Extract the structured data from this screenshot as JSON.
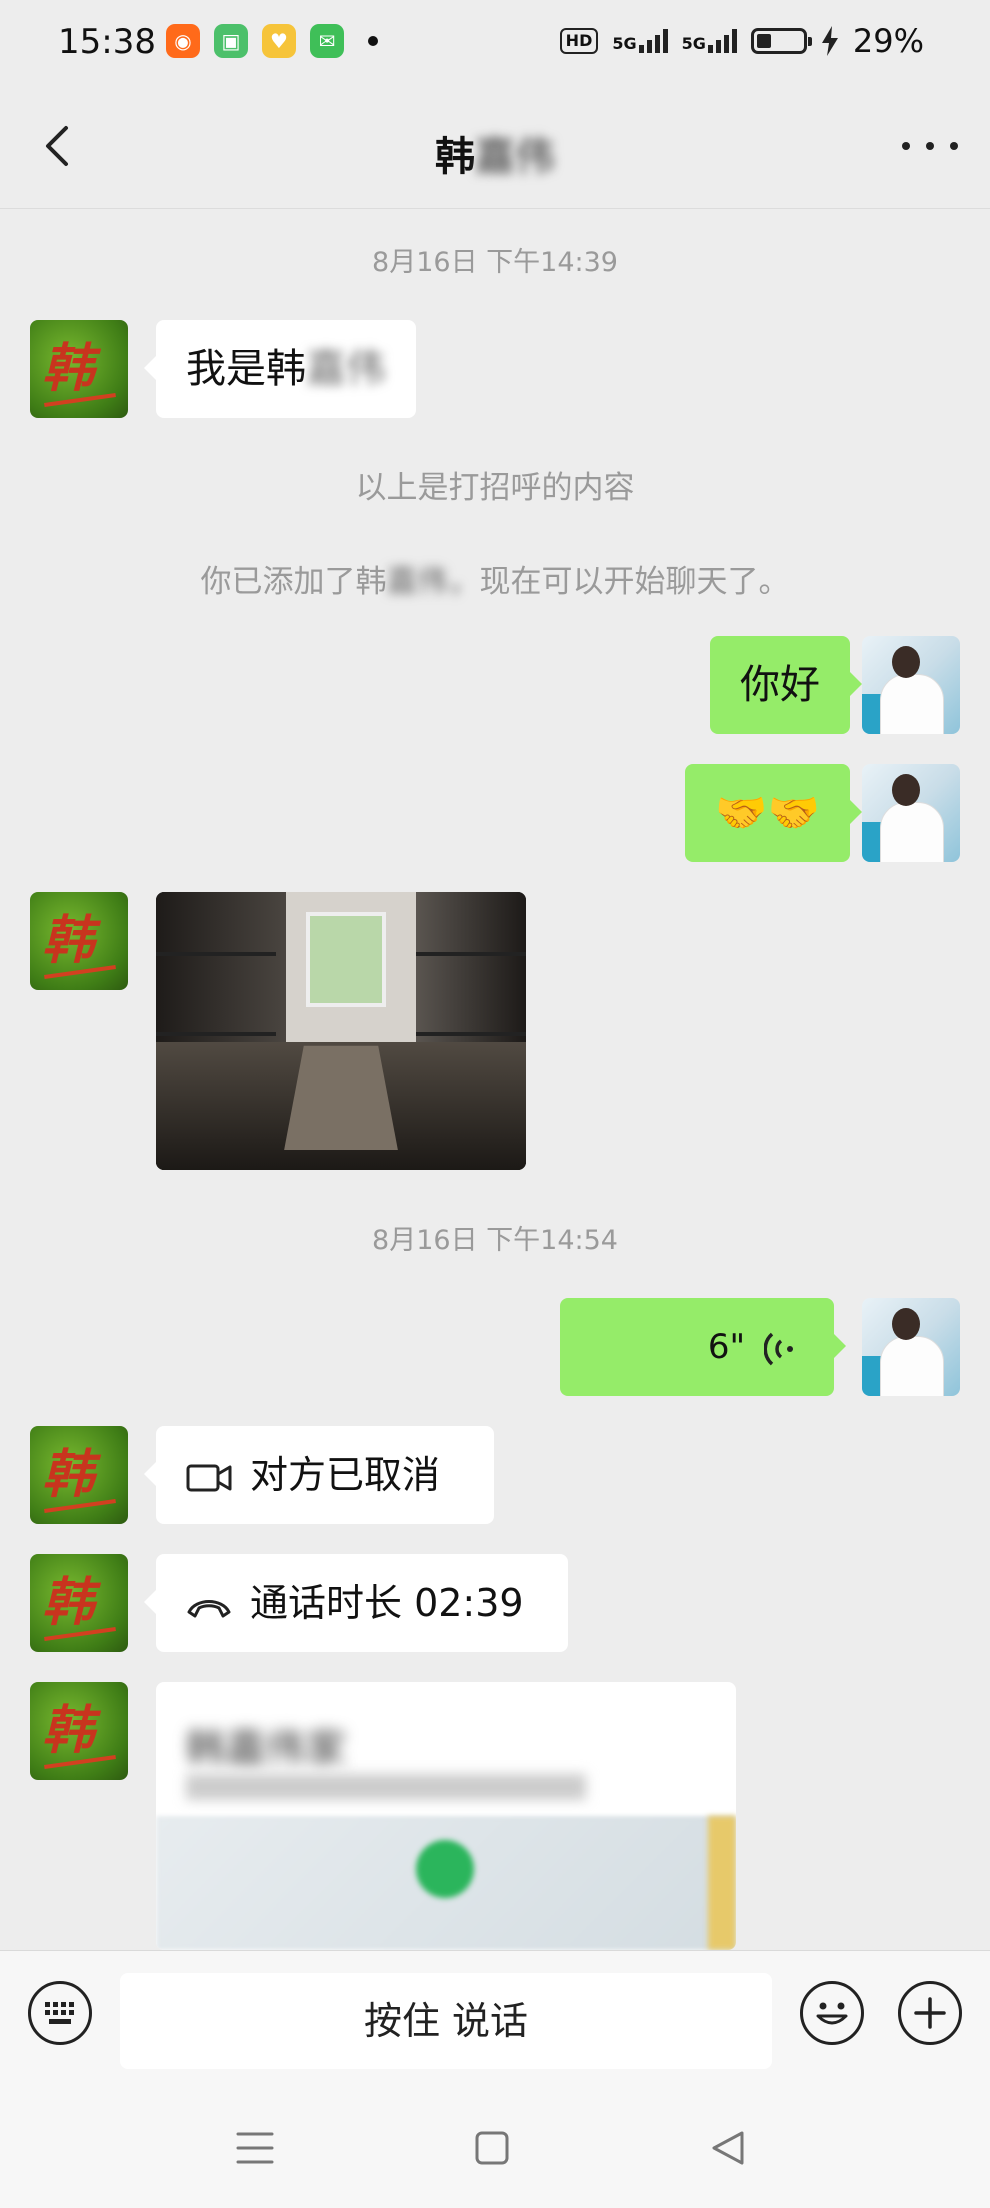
{
  "status_bar": {
    "time": "15:38",
    "app_icons": [
      {
        "name": "kuaishou-icon",
        "color": "#ff6a1a"
      },
      {
        "name": "green-app-icon",
        "color": "#4cc06a"
      },
      {
        "name": "yellow-app-icon",
        "color": "#f6c43a"
      },
      {
        "name": "message-app-icon",
        "color": "#3fbf58"
      }
    ],
    "hd": "HD",
    "network_1": "5G",
    "network_2": "5G",
    "battery": "29%",
    "battery_level": 0.29
  },
  "header": {
    "title_visible": "韩",
    "title_obscured": "嘉伟"
  },
  "messages": {
    "ts1": "8月16日 下午14:39",
    "greeting_prefix": "我是韩",
    "greeting_obscured": "嘉伟",
    "sys1": "以上是打招呼的内容",
    "sys2_a": "你已添加了韩",
    "sys2_obscured": "嘉伟，",
    "sys2_b": "现在可以开始聊天了。",
    "hello": "你好",
    "emoji": "🤝🤝",
    "ts2": "8月16日 下午14:54",
    "voice_duration": "6\"",
    "video_call": "对方已取消",
    "voice_call": "通话时长 02:39",
    "card_title_obscured": "韩嘉伟家"
  },
  "input": {
    "hold_to_talk": "按住 说话"
  },
  "colors": {
    "background": "#ededed",
    "bubble_out": "#95ec69",
    "bubble_in": "#ffffff"
  }
}
